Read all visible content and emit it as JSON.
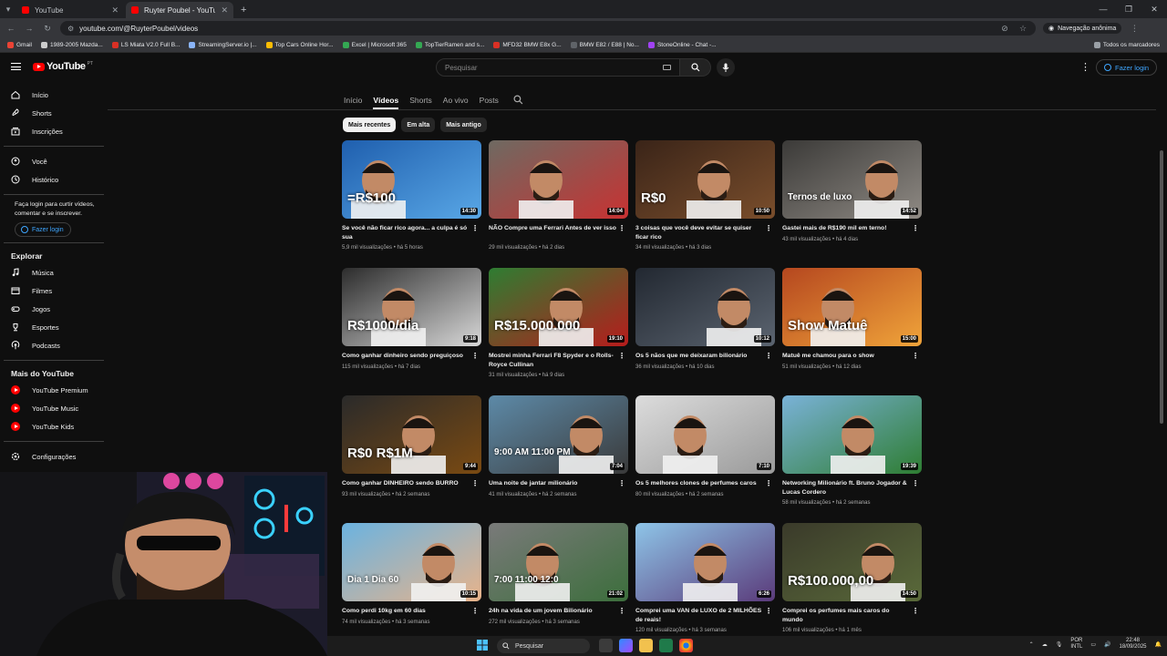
{
  "browser": {
    "tabs": [
      {
        "title": "YouTube",
        "active": false
      },
      {
        "title": "Ruyter Poubel - YouTube",
        "active": true
      }
    ],
    "url": "youtube.com/@RuyterPoubel/videos",
    "incognito_label": "Navegação anônima",
    "bookmarks": [
      {
        "label": "Gmail",
        "color": "#ea4335"
      },
      {
        "label": "1989-2005 Mazda...",
        "color": "#cccccc"
      },
      {
        "label": "LS Miata V2.0 Full B...",
        "color": "#d93025"
      },
      {
        "label": "StreamingServer.io |...",
        "color": "#8ab4f8"
      },
      {
        "label": "Top Cars Online Hor...",
        "color": "#fbbc04"
      },
      {
        "label": "Excel | Microsoft 365",
        "color": "#34a853"
      },
      {
        "label": "TopTierRamen and s...",
        "color": "#34a853"
      },
      {
        "label": "MFD32 BMW E8x G...",
        "color": "#d93025"
      },
      {
        "label": "BMW E82 / E88 | No...",
        "color": "#5f6368"
      },
      {
        "label": "StoneOnline - Chat -...",
        "color": "#a142f4"
      }
    ],
    "bookmarks_all": "Todos os marcadores"
  },
  "header": {
    "logo_text": "YouTube",
    "country": "PT",
    "search_placeholder": "Pesquisar",
    "login_label": "Fazer login"
  },
  "sidebar": {
    "main": [
      {
        "label": "Início",
        "icon": "home-icon"
      },
      {
        "label": "Shorts",
        "icon": "shorts-icon"
      },
      {
        "label": "Inscrições",
        "icon": "subscriptions-icon"
      }
    ],
    "you": [
      {
        "label": "Você",
        "icon": "you-icon"
      },
      {
        "label": "Histórico",
        "icon": "history-icon"
      }
    ],
    "login_prompt": "Faça login para curtir vídeos, comentar e se inscrever.",
    "login_label": "Fazer login",
    "explore_heading": "Explorar",
    "explore": [
      {
        "label": "Música",
        "icon": "music-icon"
      },
      {
        "label": "Filmes",
        "icon": "film-icon"
      },
      {
        "label": "Jogos",
        "icon": "gaming-icon"
      },
      {
        "label": "Esportes",
        "icon": "trophy-icon"
      },
      {
        "label": "Podcasts",
        "icon": "podcast-icon"
      }
    ],
    "more_heading": "Mais do YouTube",
    "more": [
      {
        "label": "YouTube Premium"
      },
      {
        "label": "YouTube Music"
      },
      {
        "label": "YouTube Kids"
      }
    ],
    "settings_label": "Configurações"
  },
  "channel_tabs": [
    {
      "label": "Início",
      "active": false
    },
    {
      "label": "Vídeos",
      "active": true
    },
    {
      "label": "Shorts",
      "active": false
    },
    {
      "label": "Ao vivo",
      "active": false
    },
    {
      "label": "Posts",
      "active": false
    }
  ],
  "filters": [
    {
      "label": "Mais recentes",
      "selected": true
    },
    {
      "label": "Em alta",
      "selected": false
    },
    {
      "label": "Mais antigo",
      "selected": false
    }
  ],
  "videos": [
    {
      "title": "Se você não ficar rico agora... a culpa é só sua",
      "meta": [
        "5,9 mil visualizações",
        "há 5 horas"
      ],
      "duration": "14:30",
      "overlay": "=R$100",
      "bg": [
        "#1f5fae",
        "#59a7e6"
      ]
    },
    {
      "title": "NÃO Compre uma Ferrari Antes de ver isso",
      "meta": [
        "29 mil visualizações",
        "há 2 dias"
      ],
      "duration": "14:04",
      "overlay": "",
      "bg": [
        "#6e6a62",
        "#c83232"
      ]
    },
    {
      "title": "3 coisas que você deve evitar se quiser ficar rico",
      "meta": [
        "34 mil visualizações",
        "há 3 dias"
      ],
      "duration": "10:50",
      "overlay": "R$0",
      "bg": [
        "#3a2418",
        "#7a4e2c"
      ]
    },
    {
      "title": "Gastei mais de R$190 mil em terno!",
      "meta": [
        "43 mil visualizações",
        "há 4 dias"
      ],
      "duration": "14:52",
      "overlay": "Ternos de luxo",
      "bg": [
        "#3b3a38",
        "#8f8a84"
      ]
    },
    {
      "title": "Como ganhar dinheiro sendo preguiçoso",
      "meta": [
        "115 mil visualizações",
        "há 7 dias"
      ],
      "duration": "9:18",
      "overlay": "R$1000/dia",
      "bg": [
        "#2c2c2c",
        "#d8d8d8"
      ]
    },
    {
      "title": "Mostrei minha Ferrari F8 Spyder e o Rolls-Royce Cullinan",
      "meta": [
        "31 mil visualizações",
        "há 9 dias"
      ],
      "duration": "19:10",
      "overlay": "R$15.000.000",
      "bg": [
        "#2e7d32",
        "#b71c1c"
      ]
    },
    {
      "title": "Os 5 nãos que me deixaram bilionário",
      "meta": [
        "36 mil visualizações",
        "há 10 dias"
      ],
      "duration": "10:12",
      "overlay": "",
      "bg": [
        "#222831",
        "#5b6470"
      ]
    },
    {
      "title": "Matuê me chamou para o show",
      "meta": [
        "51 mil visualizações",
        "há 12 dias"
      ],
      "duration": "15:00",
      "overlay": "Show Matuê",
      "bg": [
        "#b5471f",
        "#f0a43a"
      ]
    },
    {
      "title": "Como ganhar DINHEIRO sendo BURRO",
      "meta": [
        "93 mil visualizações",
        "há 2 semanas"
      ],
      "duration": "9:44",
      "overlay": "R$0   R$1M",
      "bg": [
        "#2a2a2a",
        "#7a4a12"
      ]
    },
    {
      "title": "Uma noite de jantar milionário",
      "meta": [
        "41 mil visualizações",
        "há 2 semanas"
      ],
      "duration": "7:04",
      "overlay": "9:00 AM    11:00 PM",
      "bg": [
        "#5d8aa8",
        "#3a3a3a"
      ]
    },
    {
      "title": "Os 5 melhores clones de perfumes caros",
      "meta": [
        "80 mil visualizações",
        "há 2 semanas"
      ],
      "duration": "7:10",
      "overlay": "",
      "bg": [
        "#dcdcdc",
        "#9a9a9a"
      ]
    },
    {
      "title": "Networking Milionário ft. Bruno Jogador & Lucas Cordero",
      "meta": [
        "58 mil visualizações",
        "há 2 semanas"
      ],
      "duration": "19:39",
      "overlay": "",
      "bg": [
        "#7ab2d8",
        "#2e7d32"
      ]
    },
    {
      "title": "Como perdi 10kg em 60 dias",
      "meta": [
        "74 mil visualizações",
        "há 3 semanas"
      ],
      "duration": "10:15",
      "overlay": "Dia 1        Dia 60",
      "bg": [
        "#6bb3e0",
        "#e8b38a"
      ]
    },
    {
      "title": "24h na vida de um jovem Bilionário",
      "meta": [
        "272 mil visualizações",
        "há 3 semanas"
      ],
      "duration": "21:02",
      "overlay": "7:00   11:00   12:0",
      "bg": [
        "#7a7a7a",
        "#3c6e3c"
      ]
    },
    {
      "title": "Comprei uma VAN de LUXO de 2 MILHÕES de reais!",
      "meta": [
        "120 mil visualizações",
        "há 3 semanas"
      ],
      "duration": "6:26",
      "overlay": "",
      "bg": [
        "#8ec5e8",
        "#5a3a7a"
      ]
    },
    {
      "title": "Comprei os perfumes mais caros do mundo",
      "meta": [
        "106 mil visualizações",
        "há 1 mês"
      ],
      "duration": "14:50",
      "overlay": "R$100.000,00",
      "bg": [
        "#3a3a2a",
        "#5a6a3a"
      ]
    }
  ],
  "taskbar": {
    "search_label": "Pesquisar",
    "lang": [
      "POR",
      "INTL"
    ],
    "time": "22:48",
    "date": "18/09/2025"
  }
}
